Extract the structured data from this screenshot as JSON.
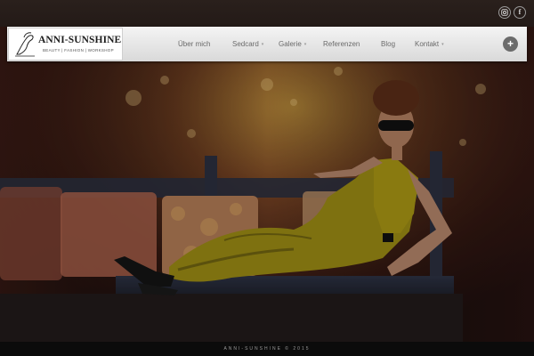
{
  "social": {
    "instagram_icon": "instagram-icon",
    "facebook_icon": "facebook-icon",
    "facebook_glyph": "f"
  },
  "logo": {
    "title": "ANNI-SUNSHINE",
    "tagline": "BEAUTY | FASHION | WORKSHOP"
  },
  "nav": {
    "items": [
      {
        "label": "Über mich"
      },
      {
        "label": "Sedcard"
      },
      {
        "label": "Galerie"
      },
      {
        "label": "Referenzen"
      },
      {
        "label": "Blog"
      },
      {
        "label": "Kontakt"
      }
    ],
    "plus_glyph": "+"
  },
  "footer": {
    "text": "ANNI-SUNSHINE © 2015"
  },
  "colors": {
    "header_bg": "#e8e8e8",
    "nav_text": "#6a6a6a",
    "footer_bg": "#0b0b0b",
    "plus_bg": "#6b6b6b"
  }
}
